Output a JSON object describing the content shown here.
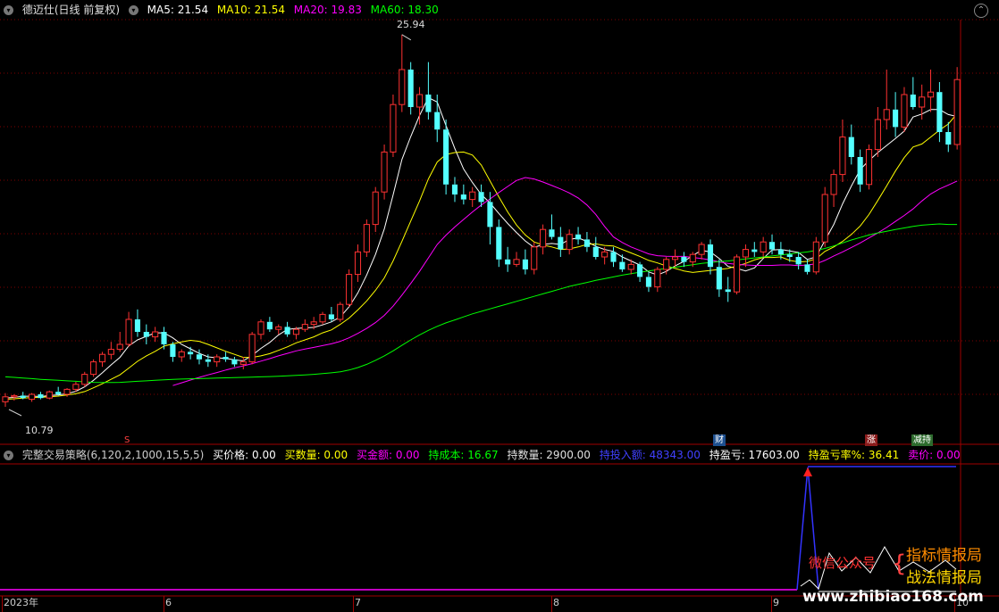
{
  "header": {
    "title": "德迈仕(日线 前复权)",
    "ma5": "MA5: 21.54",
    "ma10": "MA10: 21.54",
    "ma20": "MA20: 19.83",
    "ma60": "MA60: 18.30"
  },
  "indicator": {
    "name": "完整交易策略(6,120,2,1000,15,5,5)",
    "buy_price": "买价格: 0.00",
    "buy_qty": "买数量: 0.00",
    "buy_amount": "买金额: 0.00",
    "hold_cost": "持成本: 16.67",
    "hold_qty": "持数量: 2900.00",
    "hold_invest": "持投入额: 48343.00",
    "hold_pl": "持盈亏: 17603.00",
    "hold_pl_rate": "持盈亏率%: 36.41",
    "sell_price": "卖价: 0.00"
  },
  "colors": {
    "up": "#ff3232",
    "down": "#54ffff",
    "ma5": "#ffffff",
    "ma10": "#ffff00",
    "ma20": "#ff00ff",
    "ma60": "#00ff00",
    "grid": "#800000",
    "indicator_line": "#3333ff"
  },
  "price_labels": {
    "high": "25.94",
    "low": "10.79"
  },
  "markers": {
    "s": "S",
    "cai": "财",
    "zhang": "涨",
    "jianchi": "减持"
  },
  "axis": {
    "labels": [
      "2023年",
      "6",
      "7",
      "8",
      "9",
      "10"
    ]
  },
  "watermark": {
    "wechat": "微信公众号",
    "name1": "指标情报局",
    "name2": "战法情报局",
    "url": "www.zhibiao168.com"
  },
  "chart_data": {
    "type": "candlestick",
    "ylim": [
      10.0,
      26.5
    ],
    "candles": [
      [
        11.2,
        11.55,
        11.0,
        11.4
      ],
      [
        11.4,
        11.5,
        11.25,
        11.45
      ],
      [
        11.45,
        11.6,
        11.3,
        11.35
      ],
      [
        11.3,
        11.55,
        11.2,
        11.5
      ],
      [
        11.5,
        11.6,
        11.3,
        11.35
      ],
      [
        11.35,
        11.65,
        11.3,
        11.6
      ],
      [
        11.6,
        11.8,
        11.45,
        11.5
      ],
      [
        11.5,
        11.75,
        11.4,
        11.7
      ],
      [
        11.7,
        12.0,
        11.6,
        11.9
      ],
      [
        11.9,
        12.4,
        11.8,
        12.3
      ],
      [
        12.3,
        12.9,
        12.2,
        12.8
      ],
      [
        12.8,
        13.2,
        12.6,
        13.1
      ],
      [
        13.1,
        13.6,
        12.9,
        13.3
      ],
      [
        13.3,
        14.0,
        13.2,
        13.5
      ],
      [
        13.5,
        14.8,
        13.4,
        14.5
      ],
      [
        14.5,
        14.9,
        13.8,
        14.0
      ],
      [
        14.0,
        14.3,
        13.5,
        13.8
      ],
      [
        13.8,
        14.2,
        13.6,
        14.0
      ],
      [
        14.0,
        14.2,
        13.3,
        13.5
      ],
      [
        13.5,
        13.6,
        12.8,
        13.0
      ],
      [
        13.0,
        13.3,
        12.8,
        13.2
      ],
      [
        13.2,
        13.4,
        12.9,
        13.1
      ],
      [
        13.1,
        13.3,
        12.7,
        12.9
      ],
      [
        12.9,
        13.1,
        12.6,
        12.8
      ],
      [
        12.8,
        13.1,
        12.6,
        13.0
      ],
      [
        13.0,
        13.2,
        12.8,
        12.9
      ],
      [
        12.9,
        13.0,
        12.6,
        12.7
      ],
      [
        12.7,
        13.0,
        12.5,
        12.8
      ],
      [
        12.8,
        14.0,
        12.7,
        13.9
      ],
      [
        13.9,
        14.5,
        13.7,
        14.4
      ],
      [
        14.4,
        14.6,
        14.0,
        14.1
      ],
      [
        14.1,
        14.3,
        13.9,
        14.2
      ],
      [
        14.2,
        14.4,
        13.8,
        13.9
      ],
      [
        13.9,
        14.2,
        13.7,
        14.1
      ],
      [
        14.1,
        14.5,
        14.0,
        14.3
      ],
      [
        14.3,
        14.6,
        14.1,
        14.4
      ],
      [
        14.4,
        14.8,
        14.3,
        14.7
      ],
      [
        14.7,
        15.0,
        14.4,
        14.5
      ],
      [
        14.5,
        15.2,
        14.4,
        15.1
      ],
      [
        15.1,
        16.5,
        15.0,
        16.3
      ],
      [
        16.3,
        17.5,
        16.0,
        17.2
      ],
      [
        17.2,
        18.5,
        17.0,
        18.3
      ],
      [
        18.3,
        19.8,
        18.0,
        19.6
      ],
      [
        19.6,
        21.5,
        19.3,
        21.2
      ],
      [
        21.2,
        23.5,
        21.0,
        23.1
      ],
      [
        23.1,
        25.9,
        22.8,
        24.5
      ],
      [
        24.5,
        24.8,
        22.7,
        23.0
      ],
      [
        23.0,
        23.8,
        22.3,
        23.5
      ],
      [
        23.5,
        24.8,
        22.5,
        22.8
      ],
      [
        22.8,
        23.5,
        21.6,
        22.1
      ],
      [
        22.1,
        22.5,
        19.5,
        19.9
      ],
      [
        19.9,
        20.2,
        19.2,
        19.5
      ],
      [
        19.5,
        19.9,
        19.1,
        19.3
      ],
      [
        19.3,
        19.8,
        19.0,
        19.6
      ],
      [
        19.6,
        19.9,
        19.0,
        19.2
      ],
      [
        19.2,
        19.6,
        17.5,
        18.2
      ],
      [
        18.2,
        18.5,
        16.6,
        16.9
      ],
      [
        16.9,
        17.4,
        16.4,
        16.7
      ],
      [
        16.7,
        17.2,
        16.6,
        16.9
      ],
      [
        16.9,
        17.3,
        16.3,
        16.5
      ],
      [
        16.5,
        17.6,
        16.3,
        17.4
      ],
      [
        17.4,
        18.3,
        17.1,
        18.1
      ],
      [
        18.1,
        18.7,
        17.7,
        17.8
      ],
      [
        17.8,
        18.2,
        17.0,
        17.3
      ],
      [
        17.3,
        18.1,
        17.1,
        17.9
      ],
      [
        17.9,
        18.2,
        17.5,
        17.7
      ],
      [
        17.7,
        18.0,
        17.2,
        17.4
      ],
      [
        17.4,
        17.8,
        16.9,
        17.0
      ],
      [
        17.0,
        17.4,
        16.7,
        17.2
      ],
      [
        17.2,
        17.4,
        16.6,
        16.8
      ],
      [
        16.8,
        17.1,
        16.4,
        16.5
      ],
      [
        16.5,
        16.9,
        16.3,
        16.7
      ],
      [
        16.7,
        16.8,
        16.0,
        16.2
      ],
      [
        16.2,
        16.4,
        15.6,
        15.8
      ],
      [
        15.8,
        16.6,
        15.6,
        16.5
      ],
      [
        16.5,
        17.0,
        16.3,
        16.9
      ],
      [
        16.9,
        17.3,
        16.6,
        17.0
      ],
      [
        17.0,
        17.2,
        16.6,
        16.8
      ],
      [
        16.8,
        17.2,
        16.6,
        17.1
      ],
      [
        17.1,
        17.6,
        16.9,
        17.5
      ],
      [
        17.5,
        17.7,
        16.3,
        16.6
      ],
      [
        16.6,
        16.9,
        15.4,
        15.7
      ],
      [
        15.7,
        16.2,
        15.2,
        15.6
      ],
      [
        15.6,
        17.1,
        15.5,
        17.0
      ],
      [
        17.0,
        17.5,
        16.6,
        17.3
      ],
      [
        17.3,
        17.6,
        17.0,
        17.2
      ],
      [
        17.2,
        17.8,
        17.0,
        17.6
      ],
      [
        17.6,
        17.9,
        17.1,
        17.3
      ],
      [
        17.3,
        17.6,
        16.9,
        17.1
      ],
      [
        17.1,
        17.3,
        16.8,
        17.0
      ],
      [
        17.0,
        17.2,
        16.5,
        16.7
      ],
      [
        16.7,
        16.9,
        16.3,
        16.4
      ],
      [
        16.4,
        17.8,
        16.3,
        17.6
      ],
      [
        17.6,
        19.8,
        17.4,
        19.5
      ],
      [
        19.5,
        20.5,
        19.0,
        20.3
      ],
      [
        20.3,
        22.5,
        20.0,
        21.8
      ],
      [
        21.8,
        22.3,
        20.7,
        21.0
      ],
      [
        21.0,
        21.3,
        19.6,
        19.9
      ],
      [
        19.9,
        21.5,
        19.7,
        21.3
      ],
      [
        21.3,
        23.0,
        21.0,
        22.5
      ],
      [
        22.5,
        24.5,
        22.1,
        22.9
      ],
      [
        22.9,
        23.6,
        21.8,
        22.2
      ],
      [
        22.2,
        23.8,
        22.0,
        23.5
      ],
      [
        23.5,
        24.2,
        22.9,
        23.0
      ],
      [
        23.0,
        23.9,
        22.5,
        23.4
      ],
      [
        23.4,
        24.5,
        22.8,
        23.6
      ],
      [
        23.6,
        24.0,
        21.6,
        22.0
      ],
      [
        22.0,
        22.4,
        21.2,
        21.5
      ],
      [
        21.5,
        24.6,
        21.3,
        24.1
      ]
    ],
    "ma": {
      "MA5": [
        11.35,
        11.38,
        11.42,
        11.43,
        11.41,
        11.45,
        11.48,
        11.52,
        11.62,
        11.8,
        12.06,
        12.36,
        12.68,
        12.98,
        13.44,
        13.68,
        13.82,
        13.96,
        13.96,
        13.76,
        13.5,
        13.32,
        13.14,
        13.0,
        12.96,
        12.94,
        12.88,
        12.84,
        13.06,
        13.34,
        13.58,
        13.88,
        14.1,
        14.14,
        14.16,
        14.18,
        14.28,
        14.4,
        14.6,
        15.0,
        15.56,
        16.28,
        17.1,
        18.12,
        19.48,
        20.9,
        21.82,
        22.66,
        23.38,
        23.2,
        22.26,
        21.34,
        20.52,
        19.98,
        19.5,
        19.16,
        18.74,
        18.34,
        17.98,
        17.64,
        17.38,
        17.5,
        17.54,
        17.5,
        17.7,
        17.76,
        17.62,
        17.42,
        17.3,
        17.22,
        17.0,
        16.84,
        16.68,
        16.4,
        16.28,
        16.42,
        16.64,
        16.82,
        17.06,
        17.26,
        17.2,
        16.94,
        16.62,
        16.54,
        16.44,
        16.56,
        16.94,
        17.28,
        17.3,
        17.24,
        17.18,
        16.9,
        17.0,
        17.66,
        18.3,
        19.12,
        19.84,
        20.5,
        20.86,
        21.18,
        21.46,
        21.74,
        22.04,
        22.6,
        22.72,
        22.9,
        22.9,
        22.7,
        22.62
      ],
      "MA10": [
        11.3,
        11.32,
        11.35,
        11.37,
        11.38,
        11.4,
        11.43,
        11.47,
        11.52,
        11.61,
        11.76,
        11.92,
        12.1,
        12.28,
        12.55,
        12.82,
        13.04,
        13.22,
        13.43,
        13.52,
        13.6,
        13.66,
        13.62,
        13.5,
        13.36,
        13.22,
        13.1,
        12.98,
        12.98,
        13.04,
        13.13,
        13.26,
        13.4,
        13.56,
        13.68,
        13.8,
        13.96,
        14.08,
        14.3,
        14.55,
        14.88,
        15.24,
        15.66,
        16.16,
        16.84,
        17.62,
        18.44,
        19.24,
        20.12,
        20.8,
        21.1,
        21.18,
        21.2,
        21.08,
        20.68,
        20.04,
        19.4,
        18.8,
        18.28,
        17.88,
        17.6,
        17.48,
        17.4,
        17.3,
        17.32,
        17.4,
        17.5,
        17.52,
        17.46,
        17.44,
        17.3,
        17.16,
        17.02,
        16.86,
        16.76,
        16.64,
        16.54,
        16.44,
        16.38,
        16.42,
        16.46,
        16.5,
        16.54,
        16.64,
        16.74,
        16.88,
        16.98,
        16.98,
        17.0,
        16.86,
        16.8,
        16.82,
        16.92,
        17.22,
        17.4,
        17.62,
        17.9,
        18.24,
        18.7,
        19.26,
        19.84,
        20.44,
        20.98,
        21.4,
        21.52,
        21.8,
        22.08,
        22.32,
        22.74
      ],
      "MA20": [
        null,
        null,
        null,
        null,
        null,
        null,
        null,
        null,
        null,
        null,
        null,
        null,
        null,
        null,
        null,
        null,
        null,
        null,
        null,
        11.85,
        11.96,
        12.07,
        12.18,
        12.28,
        12.37,
        12.47,
        12.56,
        12.64,
        12.73,
        12.83,
        12.93,
        13.04,
        13.14,
        13.24,
        13.31,
        13.38,
        13.45,
        13.52,
        13.62,
        13.76,
        13.94,
        14.14,
        14.37,
        14.66,
        15.03,
        15.47,
        15.94,
        16.42,
        16.96,
        17.5,
        17.87,
        18.2,
        18.5,
        18.8,
        19.08,
        19.32,
        19.58,
        19.82,
        20.06,
        20.18,
        20.12,
        20.0,
        19.86,
        19.72,
        19.56,
        19.36,
        19.08,
        18.7,
        18.22,
        17.8,
        17.58,
        17.4,
        17.26,
        17.12,
        17.05,
        17.03,
        17.02,
        17.02,
        16.98,
        16.94,
        16.88,
        16.8,
        16.74,
        16.7,
        16.68,
        16.66,
        16.66,
        16.66,
        16.68,
        16.68,
        16.65,
        16.68,
        16.72,
        16.86,
        17.04,
        17.2,
        17.38,
        17.56,
        17.76,
        17.96,
        18.18,
        18.42,
        18.66,
        18.92,
        19.24,
        19.52,
        19.72,
        19.88,
        20.04
      ],
      "MA60": [
        12.2,
        12.18,
        12.15,
        12.13,
        12.1,
        12.08,
        12.06,
        12.04,
        12.02,
        12.0,
        11.98,
        11.97,
        11.97,
        11.98,
        12.0,
        12.02,
        12.04,
        12.06,
        12.08,
        12.1,
        12.11,
        12.12,
        12.13,
        12.14,
        12.15,
        12.16,
        12.17,
        12.18,
        12.19,
        12.2,
        12.21,
        12.22,
        12.24,
        12.26,
        12.28,
        12.3,
        12.33,
        12.36,
        12.4,
        12.47,
        12.57,
        12.7,
        12.86,
        13.04,
        13.24,
        13.46,
        13.68,
        13.88,
        14.06,
        14.22,
        14.36,
        14.48,
        14.6,
        14.72,
        14.82,
        14.92,
        15.02,
        15.12,
        15.22,
        15.32,
        15.42,
        15.52,
        15.62,
        15.72,
        15.82,
        15.9,
        15.98,
        16.06,
        16.13,
        16.2,
        16.27,
        16.33,
        16.39,
        16.44,
        16.49,
        16.54,
        16.59,
        16.64,
        16.69,
        16.74,
        16.78,
        16.81,
        16.84,
        16.88,
        16.92,
        16.96,
        17.0,
        17.04,
        17.08,
        17.12,
        17.16,
        17.2,
        17.26,
        17.34,
        17.44,
        17.56,
        17.68,
        17.78,
        17.88,
        17.96,
        18.03,
        18.1,
        18.16,
        18.22,
        18.27,
        18.3,
        18.32,
        18.3,
        18.3
      ]
    }
  }
}
